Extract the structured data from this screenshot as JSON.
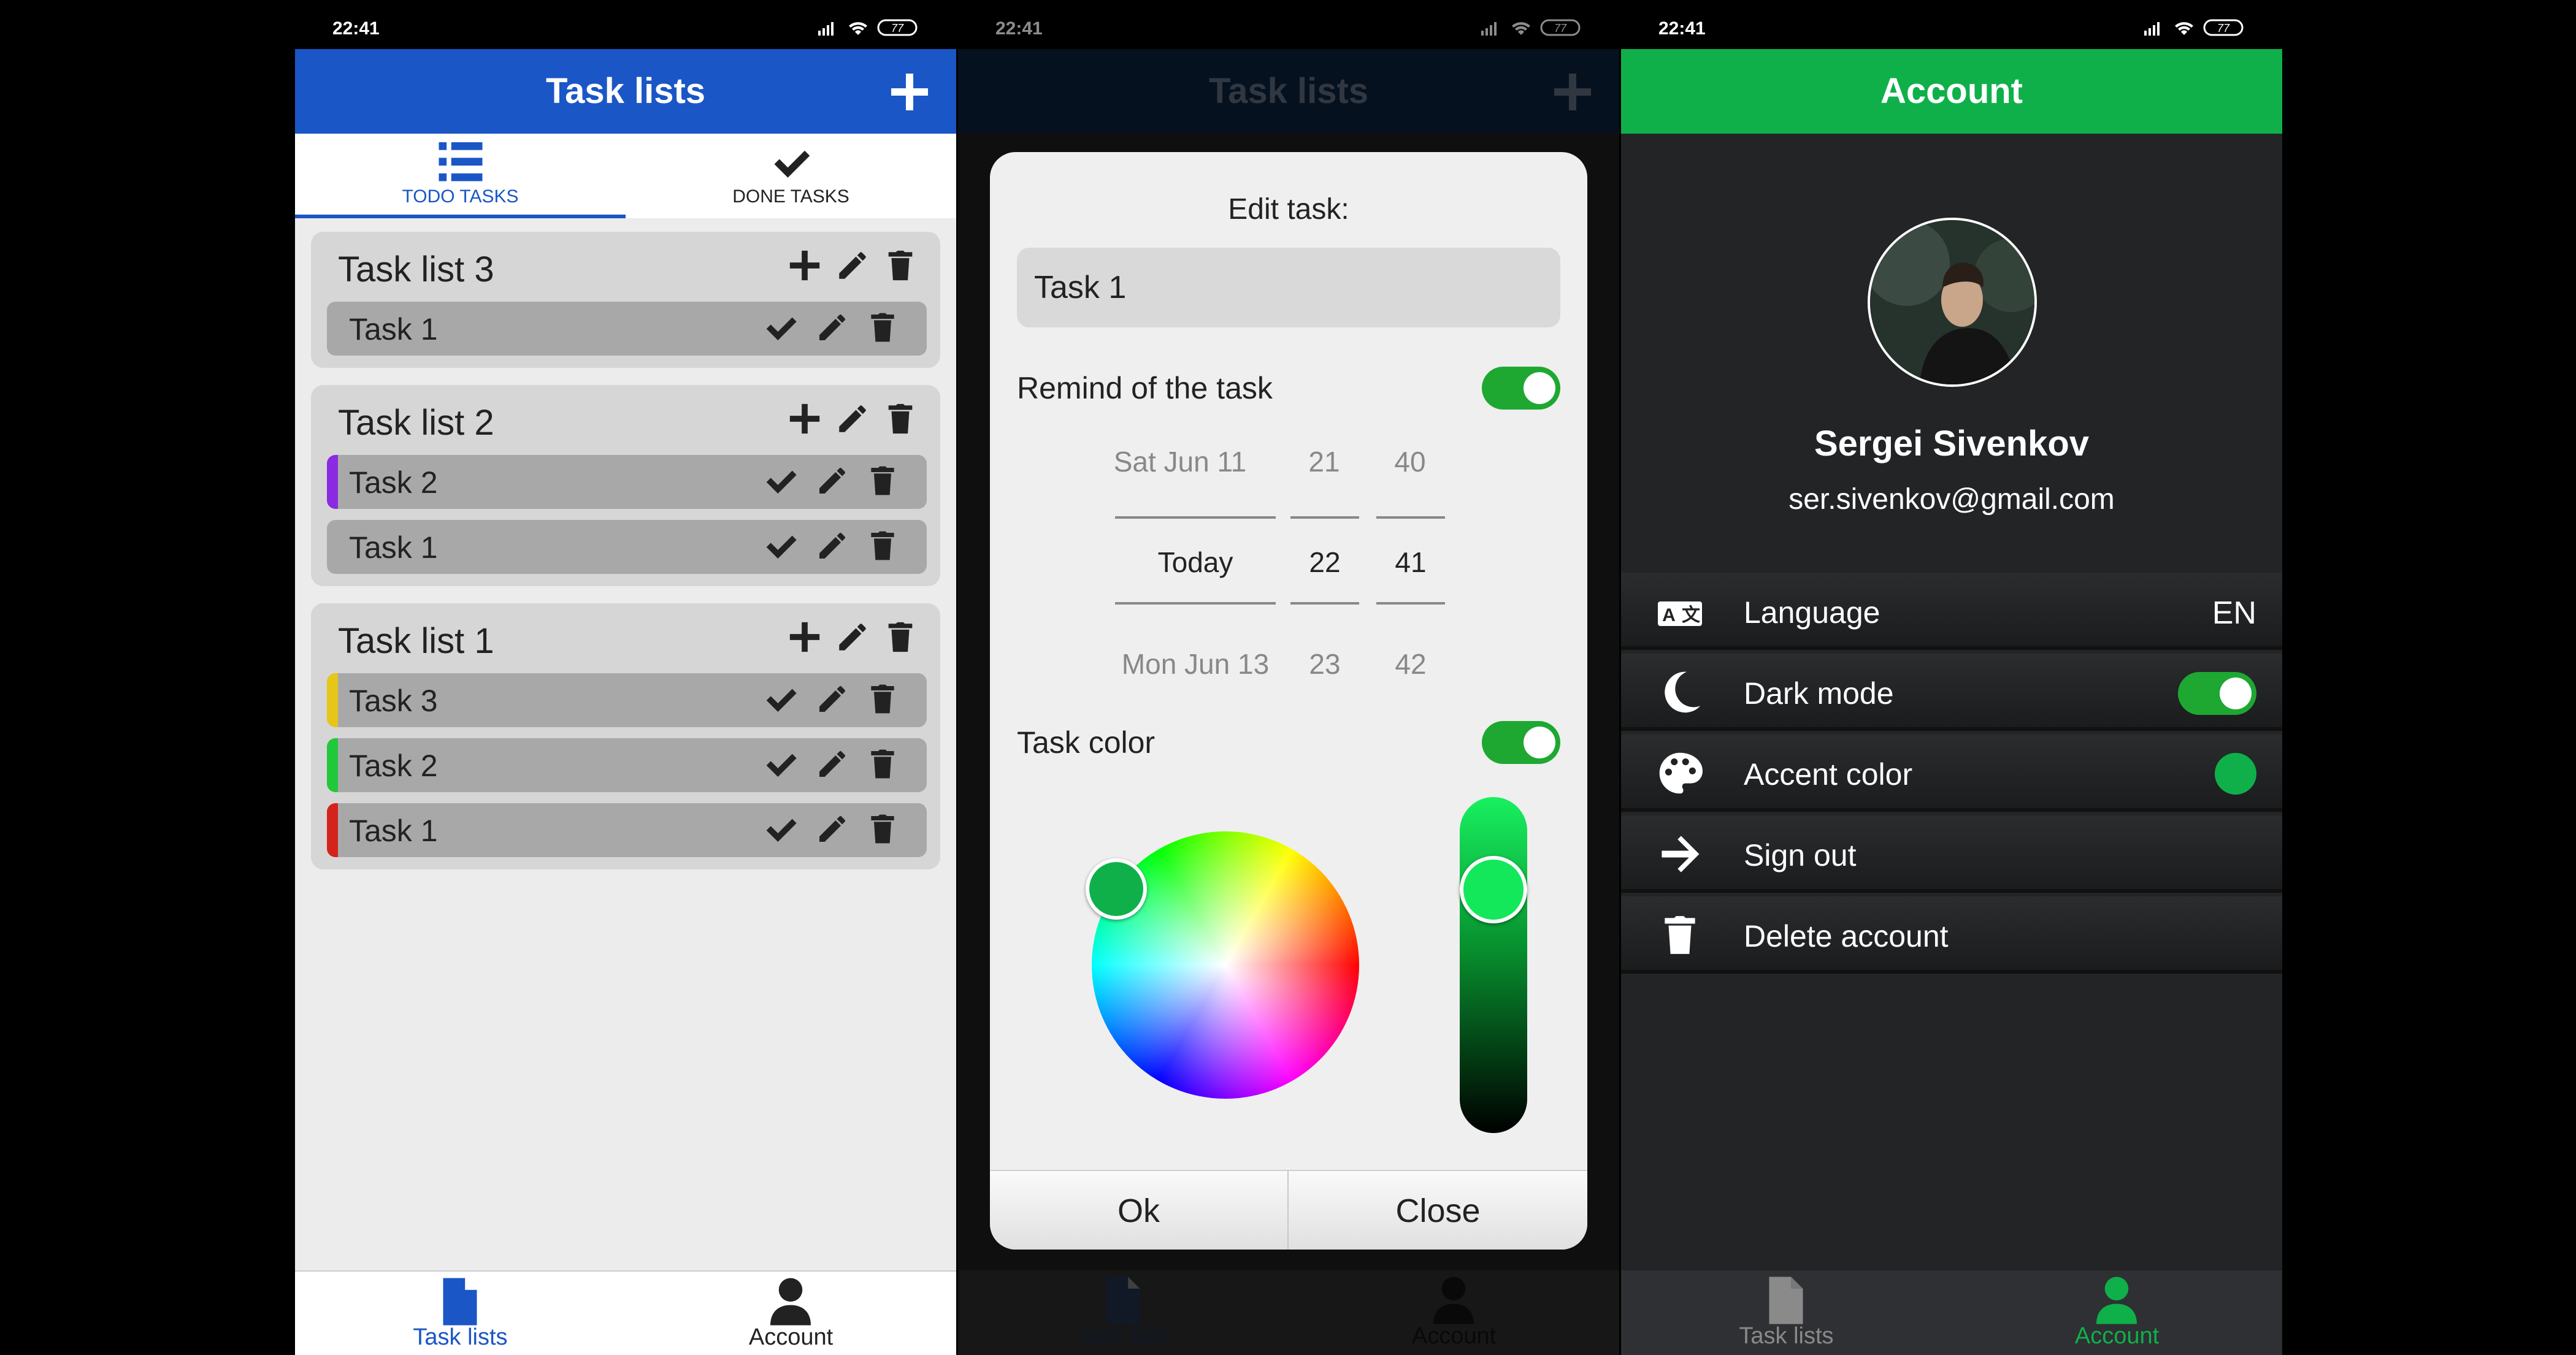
{
  "colors": {
    "blue_accent": "#1a56c6",
    "green_accent": "#0fb04a",
    "toggle_on": "#1ea832",
    "task_purple": "#8a2be2",
    "task_yellow": "#e6c619",
    "task_green": "#21c83a",
    "task_red": "#d4231c"
  },
  "status": {
    "time": "22:41",
    "battery": "77"
  },
  "screen1": {
    "title": "Task lists",
    "tabs": [
      {
        "label": "TODO TASKS",
        "icon": "list-icon",
        "active": true
      },
      {
        "label": "DONE TASKS",
        "icon": "check-icon",
        "active": false
      }
    ],
    "lists": [
      {
        "name": "Task list 3",
        "tasks": [
          {
            "name": "Task 1",
            "color": ""
          }
        ]
      },
      {
        "name": "Task list 2",
        "tasks": [
          {
            "name": "Task 2",
            "color": "#8a2be2"
          },
          {
            "name": "Task 1",
            "color": ""
          }
        ]
      },
      {
        "name": "Task list 1",
        "tasks": [
          {
            "name": "Task 3",
            "color": "#e6c619"
          },
          {
            "name": "Task 2",
            "color": "#21c83a"
          },
          {
            "name": "Task 1",
            "color": "#d4231c"
          }
        ]
      }
    ],
    "nav": [
      {
        "label": "Task lists",
        "icon": "document-icon"
      },
      {
        "label": "Account",
        "icon": "person-icon"
      }
    ]
  },
  "screen2": {
    "background_title": "Task lists",
    "dialog_title": "Edit task:",
    "task_name": "Task 1",
    "remind_label": "Remind of the task",
    "remind_on": true,
    "date_picker": {
      "dates": [
        "Sat Jun 11",
        "Today",
        "Mon Jun 13"
      ],
      "hours": [
        "21",
        "22",
        "23"
      ],
      "minutes": [
        "40",
        "41",
        "42"
      ]
    },
    "color_label": "Task color",
    "color_on": true,
    "selected_color": "#0fb04a",
    "ok_label": "Ok",
    "close_label": "Close",
    "nav": [
      {
        "label": "Task lists",
        "icon": "document-icon"
      },
      {
        "label": "Account",
        "icon": "person-icon"
      }
    ]
  },
  "screen3": {
    "title": "Account",
    "user_name": "Sergei Sivenkov",
    "user_email": "ser.sivenkov@gmail.com",
    "menu": [
      {
        "label": "Language",
        "value": "EN",
        "icon": "translate-icon"
      },
      {
        "label": "Dark mode",
        "value": "",
        "icon": "moon-icon"
      },
      {
        "label": "Accent color",
        "value": "",
        "icon": "palette-icon"
      },
      {
        "label": "Sign out",
        "value": "",
        "icon": "arrow-right-icon"
      },
      {
        "label": "Delete account",
        "value": "",
        "icon": "trash-icon"
      }
    ],
    "nav": [
      {
        "label": "Task lists",
        "icon": "document-icon"
      },
      {
        "label": "Account",
        "icon": "person-icon"
      }
    ]
  }
}
